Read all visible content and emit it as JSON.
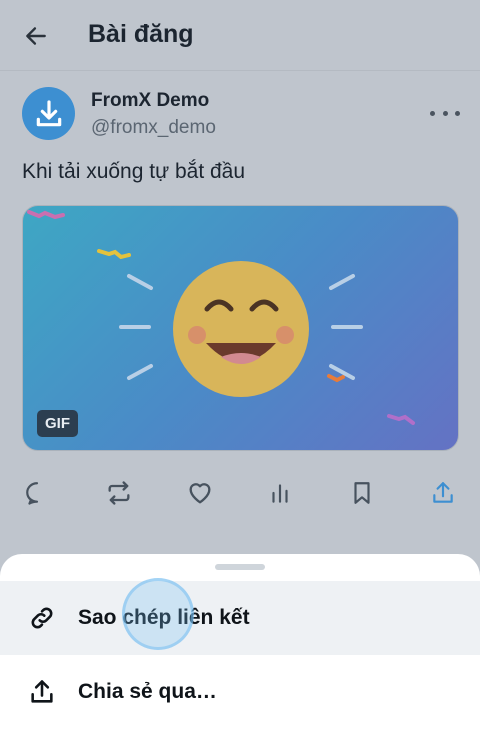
{
  "header": {
    "title": "Bài đăng"
  },
  "author": {
    "name": "FromX Demo",
    "handle": "@fromx_demo"
  },
  "post": {
    "text": "Khi tải xuống tự bắt đầu",
    "media_badge": "GIF"
  },
  "sheet": {
    "items": [
      {
        "label": "Sao chép liên kết",
        "icon": "link-icon"
      },
      {
        "label": "Chia sẻ qua…",
        "icon": "share-icon"
      }
    ]
  },
  "colors": {
    "accent": "#3d8fd1",
    "sheet_bg": "#ffffff",
    "dimmed_bg": "#bfc5cd"
  }
}
